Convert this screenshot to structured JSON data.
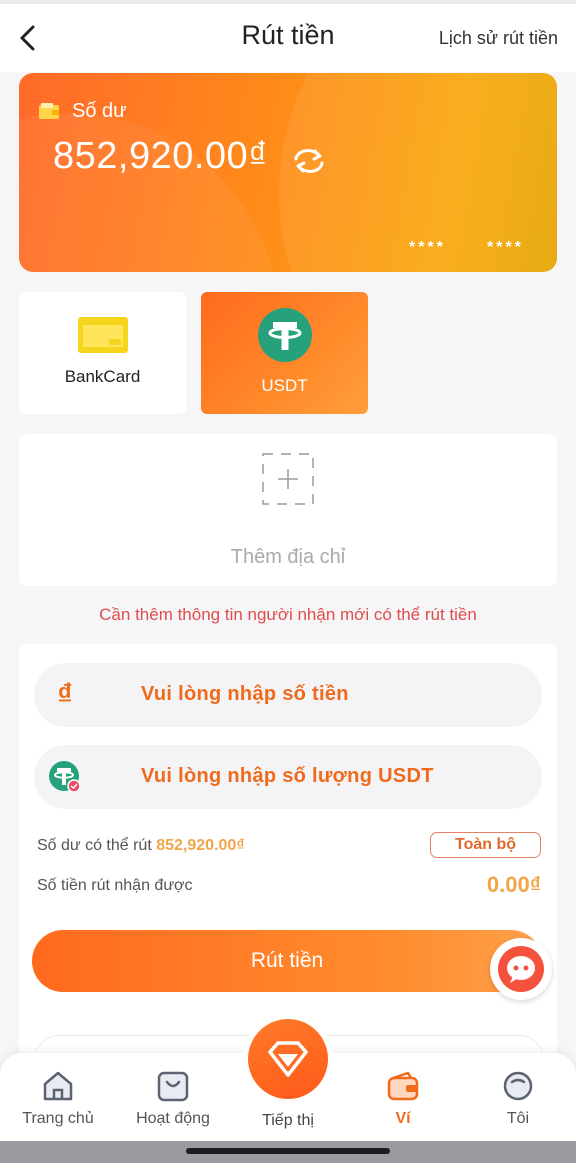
{
  "header": {
    "title": "Rút tiền",
    "history_link": "Lịch sử rút tiền"
  },
  "balance_card": {
    "label": "Số dư",
    "amount": "852,920.00₫",
    "mask_group_1": "****",
    "mask_group_2": "****"
  },
  "methods": [
    {
      "label": "BankCard",
      "icon": "bank-card-icon",
      "selected": false
    },
    {
      "label": "USDT",
      "icon": "tether-icon",
      "selected": true
    }
  ],
  "address": {
    "add_label": "Thêm địa chỉ"
  },
  "warning": "Cần thêm thông tin người nhận mới có thể rút tiền",
  "form": {
    "amount_placeholder": "Vui lòng nhập số tiền",
    "usdt_placeholder": "Vui lòng nhập số lượng USDT",
    "currency_symbol": "₫",
    "available_label": "Số dư có thể rút",
    "available_amount": "852,920.00₫",
    "all_button": "Toàn bộ",
    "receive_label": "Số tiền rút nhận được",
    "receive_amount": "0.00₫",
    "submit_button": "Rút tiền"
  },
  "nav": {
    "items": [
      {
        "label": "Trang chủ",
        "icon": "home-icon",
        "active": false
      },
      {
        "label": "Hoạt động",
        "icon": "activity-bag-icon",
        "active": false
      },
      {
        "label": "Tiếp thị",
        "icon": "diamond-icon",
        "active": false
      },
      {
        "label": "Ví",
        "icon": "wallet-icon",
        "active": true
      },
      {
        "label": "Tôi",
        "icon": "profile-icon",
        "active": false
      }
    ]
  },
  "colors": {
    "accent": "#f06a1c",
    "warning": "#e04d4d",
    "amount": "#f2a54a",
    "usdt_green": "#26a17b"
  }
}
